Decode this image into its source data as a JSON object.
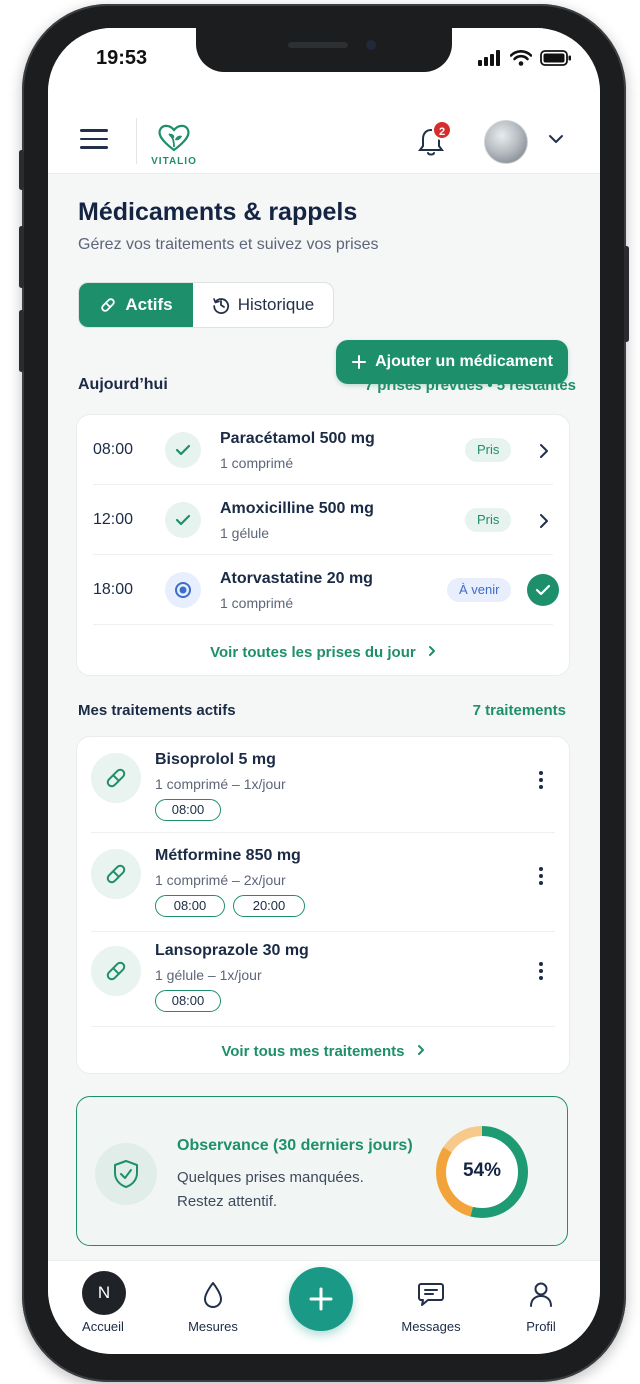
{
  "status_bar": {
    "time": "19:53"
  },
  "header": {
    "logo_text": "VITALIO",
    "notification_count": "2"
  },
  "page": {
    "title": "Médicaments & rappels",
    "subtitle": "Gérez vos traitements et suivez vos prises"
  },
  "tabs": [
    {
      "label": "Actifs",
      "active": true
    },
    {
      "label": "Historique",
      "active": false
    }
  ],
  "add_button": {
    "label": "Ajouter un médicament"
  },
  "today": {
    "title": "Aujourd’hui",
    "summary": "7 prises prévues • 5 restantes",
    "doses": [
      {
        "time": "08:00",
        "name": "Paracétamol 500 mg",
        "dose": "1 comprimé",
        "status": "Pris"
      },
      {
        "time": "12:00",
        "name": "Amoxicilline 500 mg",
        "dose": "1 gélule",
        "status": "Pris"
      },
      {
        "time": "18:00",
        "name": "Atorvastatine 20 mg",
        "dose": "1 comprimé",
        "status": "À venir"
      }
    ],
    "link": "Voir toutes les prises du jour"
  },
  "treatments": {
    "title": "Mes traitements actifs",
    "count": "7 traitements",
    "items": [
      {
        "name": "Bisoprolol 5 mg",
        "dose": "1 comprimé – 1x/jour",
        "times": [
          "08:00"
        ]
      },
      {
        "name": "Métformine 850 mg",
        "dose": "1 comprimé – 2x/jour",
        "times": [
          "08:00",
          "20:00"
        ]
      },
      {
        "name": "Lansoprazole 30 mg",
        "dose": "1 gélule – 1x/jour",
        "times": [
          "08:00"
        ]
      }
    ],
    "link": "Voir tous mes traitements"
  },
  "adherence": {
    "title": "Observance (30 derniers jours)",
    "line1": "Quelques prises manquées.",
    "line2": "Restez attentif.",
    "percent_label": "54%",
    "segments": [
      {
        "label": "taken",
        "fraction": 0.54,
        "color": "#1e9b73"
      },
      {
        "label": "missed",
        "fraction": 0.3,
        "color": "#f2a43a"
      },
      {
        "label": "partial",
        "fraction": 0.16,
        "color": "#f7c98a"
      }
    ]
  },
  "bottom_nav": {
    "avatar_initial": "N",
    "items": [
      "Accueil",
      "Mesures",
      "Messages",
      "Profil"
    ]
  },
  "colors": {
    "accent": "#1e8f6b",
    "upcoming": "#3d6cc9",
    "notification": "#d62e2e"
  }
}
